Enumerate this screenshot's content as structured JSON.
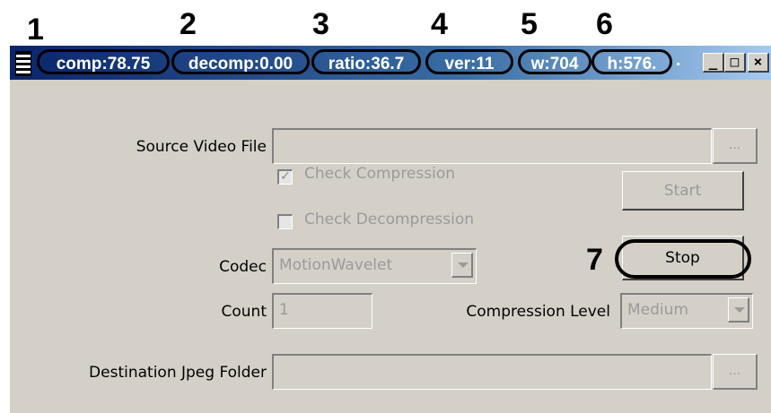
{
  "callouts": {
    "n1": "1",
    "n2": "2",
    "n3": "3",
    "n4": "4",
    "n5": "5",
    "n6": "6",
    "n7": "7"
  },
  "titlebar": {
    "segments": {
      "comp": "comp:78.75",
      "decomp": "decomp:0.00",
      "ratio": "ratio:36.7",
      "ver": "ver:11",
      "w": "w:704",
      "h": "h:576."
    },
    "trailing": ".",
    "min_glyph": "_",
    "max_glyph": "□",
    "close_glyph": "×"
  },
  "form": {
    "source_label": "Source Video File",
    "source_value": "",
    "browse_label": "...",
    "check_compression_label": "Check Compression",
    "check_compression_checked": true,
    "check_compression_mark": "✓",
    "check_decompression_label": "Check Decompression",
    "check_decompression_checked": false,
    "start_label": "Start",
    "stop_label": "Stop",
    "codec_label": "Codec",
    "codec_value": "MotionWavelet",
    "count_label": "Count",
    "count_value": "1",
    "compression_level_label": "Compression Level",
    "compression_level_value": "Medium",
    "dest_label": "Destination Jpeg Folder",
    "dest_value": ""
  },
  "colors": {
    "title_gradient_start": "#0a246a",
    "title_gradient_end": "#a6caf0",
    "face": "#d4d0c8",
    "disabled_text": "#9a9a9a"
  },
  "icons": [
    "app-icon",
    "minimize-icon",
    "maximize-icon",
    "close-icon",
    "dropdown-arrow-icon",
    "check-icon"
  ]
}
